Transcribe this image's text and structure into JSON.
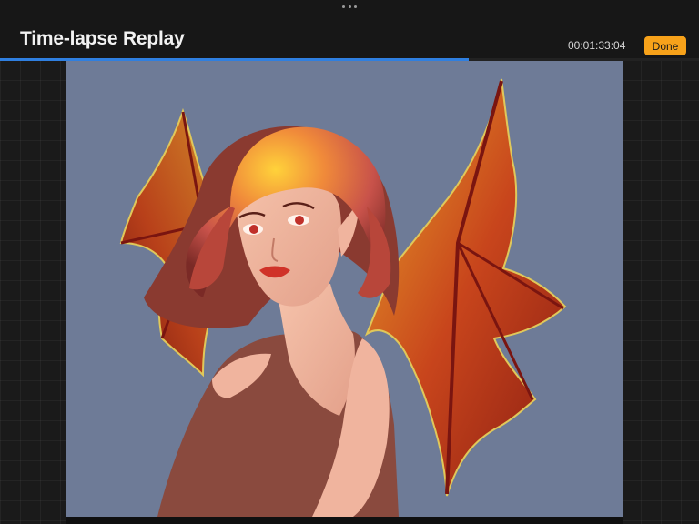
{
  "header": {
    "title": "Time-lapse Replay",
    "elapsed_time": "00:01:33:04",
    "done_label": "Done",
    "menu_icon": "more-dots-icon"
  },
  "playback": {
    "progress_fraction": 0.67
  },
  "artwork": {
    "subject": "painting of a red-haired woman with red and orange dragon wings",
    "background_color": "#6e7b97"
  },
  "colors": {
    "accent_done": "#f7a21a",
    "progress": "#2f7fe0"
  }
}
